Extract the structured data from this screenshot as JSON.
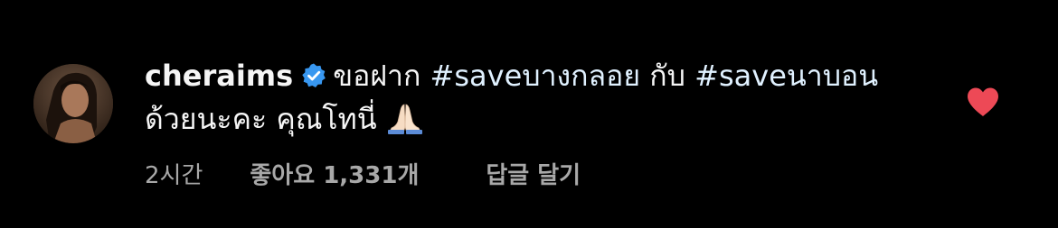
{
  "comment": {
    "username": "cheraims",
    "verified": true,
    "text_part1": "ขอฝาก ",
    "hashtag1": "#saveบางกลอย",
    "text_part2": " กับ ",
    "hashtag2": "#saveนาบอน",
    "text_part3": "ด้วยนะคะ คุณโทนี่",
    "emoji": "folded-hands-icon",
    "time": "2시간",
    "likes": "좋아요 1,331개",
    "reply_label": "답글 달기",
    "liked": true
  },
  "colors": {
    "background": "#000000",
    "text": "#f5f5f5",
    "hashtag": "#e0f1ff",
    "meta": "#a8a8a8",
    "verified_badge": "#3897f0",
    "heart": "#ed4956"
  }
}
